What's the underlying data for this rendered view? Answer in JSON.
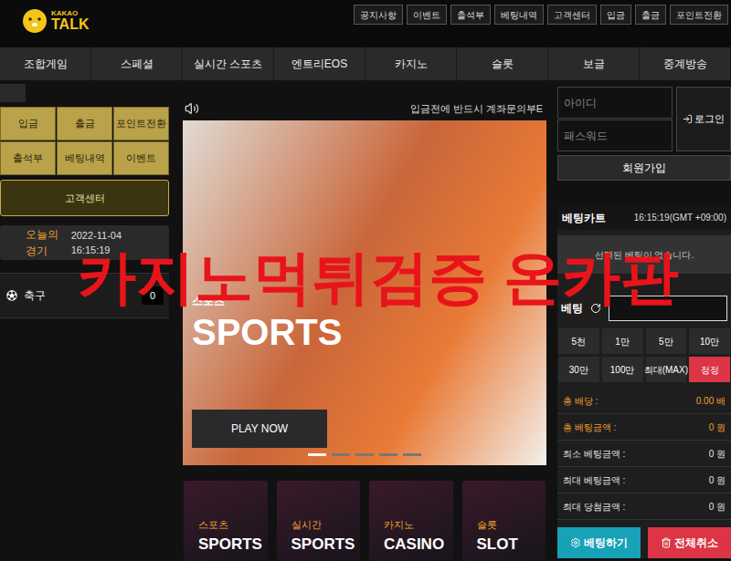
{
  "header": {
    "logo": {
      "top": "KAKAO",
      "bottom": "TALK"
    },
    "top_links": [
      "공지사항",
      "이벤트",
      "출석부",
      "베팅내역",
      "고객센터",
      "입금",
      "출금",
      "포인트전환"
    ]
  },
  "nav": {
    "items": [
      "조합게임",
      "스페셜",
      "실시간 스포츠",
      "엔트리EOS",
      "카지노",
      "슬롯",
      "보글",
      "중계방송"
    ]
  },
  "left": {
    "quick_buttons": [
      "입금",
      "출금",
      "포인트전환",
      "출석부",
      "베팅내역",
      "이벤트"
    ],
    "support_button": "고객센터",
    "today": {
      "title": "오늘의 경기",
      "datetime": "2022-11-04 16:15:19"
    },
    "sports": [
      {
        "name": "축구",
        "count": "0"
      }
    ]
  },
  "notice": "입금전에 반드시 계좌문의부E",
  "banner": {
    "category": "스포츠",
    "title": "SPORTS",
    "button": "PLAY NOW",
    "slides": [
      {
        "selected": true
      },
      {
        "selected": false
      },
      {
        "selected": false
      },
      {
        "selected": false
      },
      {
        "selected": false
      }
    ]
  },
  "game_cards": [
    {
      "label": "스포츠",
      "title": "SPORTS"
    },
    {
      "label": "실시간",
      "title": "SPORTS"
    },
    {
      "label": "카지노",
      "title": "CASINO"
    },
    {
      "label": "슬롯",
      "title": "SLOT"
    }
  ],
  "login": {
    "id_placeholder": "아이디",
    "pw_placeholder": "패스워드",
    "login_button": "로그인",
    "signup_button": "회원가입"
  },
  "bet_cart": {
    "title": "베팅카트",
    "time": "16:15:19(GMT +09:00)",
    "empty": "선택된 베팅이 없습니다.",
    "bet_label": "베팅",
    "amount_buttons": [
      {
        "label": "5천",
        "kind": "amount"
      },
      {
        "label": "1만",
        "kind": "amount"
      },
      {
        "label": "5만",
        "kind": "amount"
      },
      {
        "label": "10만",
        "kind": "amount"
      },
      {
        "label": "30만",
        "kind": "amount"
      },
      {
        "label": "100만",
        "kind": "amount"
      },
      {
        "label": "최대(MAX)",
        "kind": "amount"
      },
      {
        "label": "정정",
        "kind": "reset"
      }
    ],
    "summary": [
      {
        "label": "총 배당 :",
        "value": "0.00 배",
        "color": "#f0a030"
      },
      {
        "label": "총 베팅금액 :",
        "value": "0 원",
        "color": "#f0a030"
      },
      {
        "label": "최소 베팅금액 :",
        "value": "0 원",
        "color": "#e5e5e5"
      },
      {
        "label": "최대 베팅금액 :",
        "value": "0 원",
        "color": "#e5e5e5"
      },
      {
        "label": "최대 당첨금액 :",
        "value": "0 원",
        "color": "#e5e5e5"
      }
    ],
    "actions": [
      {
        "label": "베팅하기",
        "kind": "bet",
        "color": "#17a2b8"
      },
      {
        "label": "전체취소",
        "kind": "cancel",
        "color": "#dc3545"
      }
    ]
  },
  "watermark": "카지노먹튀검증 온카판"
}
